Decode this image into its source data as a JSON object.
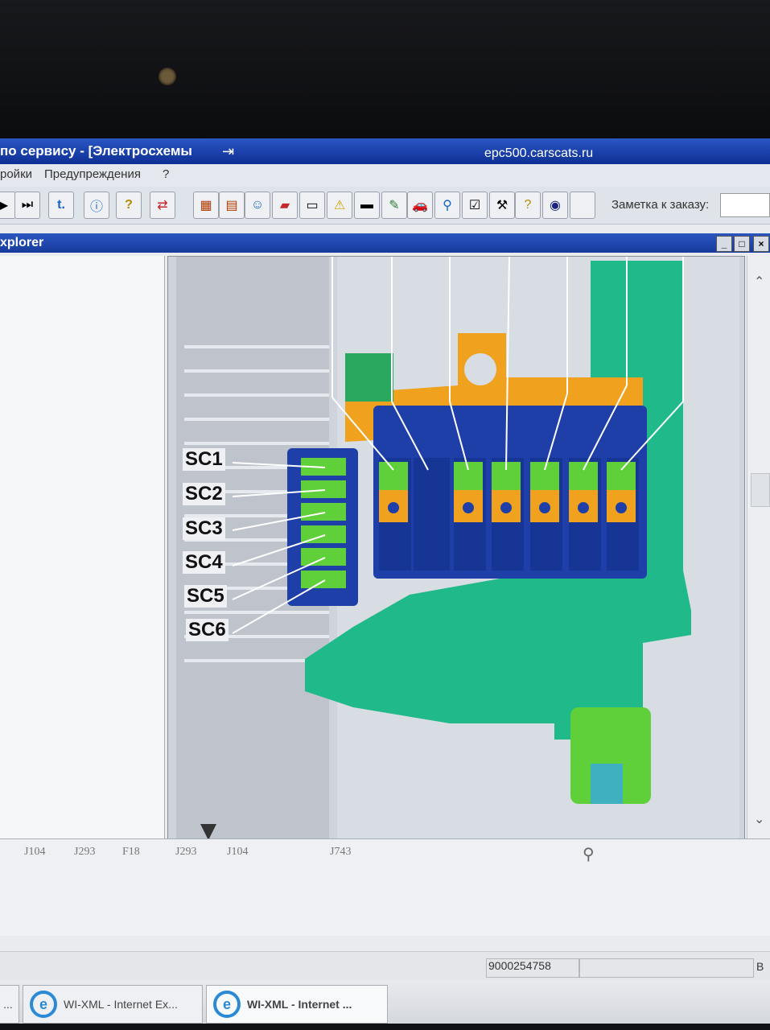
{
  "window": {
    "title": "по сервису - [Электросхемы",
    "url": "epc500.carscats.ru"
  },
  "menu": {
    "items": [
      "ройки",
      "Предупреждения",
      "?"
    ]
  },
  "toolbar": {
    "note_label": "Заметка к заказу:",
    "note_value": ""
  },
  "explorer": {
    "title": "xplorer"
  },
  "diagram": {
    "labels": [
      "SC1",
      "SC2",
      "SC3",
      "SC4",
      "SC5",
      "SC6"
    ],
    "colors": {
      "fuse_box": "#1e3fa8",
      "fuses": "#4cc226",
      "bracket": "#f0a21e",
      "housing": "#20b98a"
    }
  },
  "references": [
    "J104",
    "J293",
    "F18",
    "J293",
    "J104",
    "J743"
  ],
  "status": {
    "number": "9000254758",
    "letter": "B"
  },
  "taskbar": {
    "items": [
      "...",
      "WI-XML - Internet Ex...",
      "WI-XML - Internet ..."
    ]
  }
}
